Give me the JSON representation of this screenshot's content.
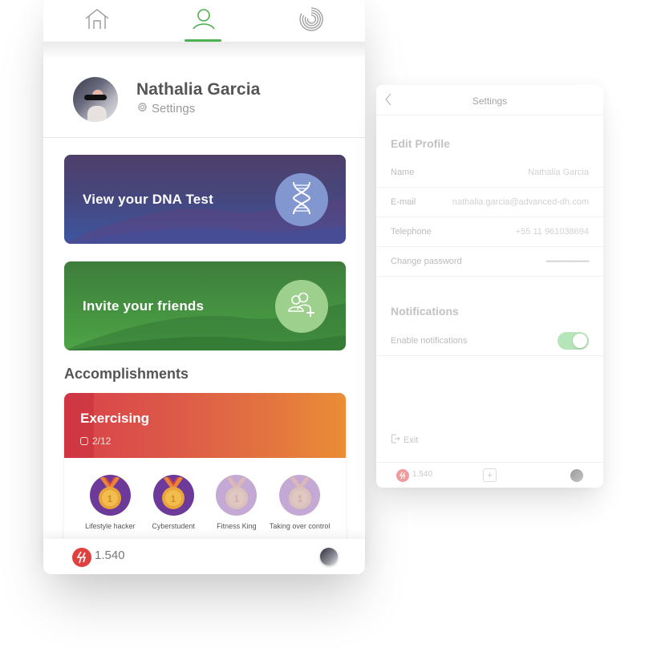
{
  "profile_screen": {
    "top_nav": {
      "tabs": [
        {
          "icon": "home-icon",
          "active": false
        },
        {
          "icon": "user-icon",
          "active": true
        },
        {
          "icon": "progress-rings-icon",
          "active": false
        }
      ],
      "active_color": "#4caf50"
    },
    "user": {
      "name": "Nathalia Garcia",
      "settings_label": "Settings"
    },
    "cards": [
      {
        "label": "View your DNA Test",
        "icon": "dna-icon"
      },
      {
        "label": "Invite your friends",
        "icon": "add-friends-icon"
      }
    ],
    "accomplishments": {
      "title": "Accomplishments",
      "category": {
        "title": "Exercising",
        "progress": "2/12"
      },
      "badges": [
        {
          "label": "Lifestyle hacker",
          "rank": "1",
          "earned": true
        },
        {
          "label": "Cyberstudent",
          "rank": "1",
          "earned": true
        },
        {
          "label": "Fitness King",
          "rank": "1",
          "earned": false
        },
        {
          "label": "Taking over control",
          "rank": "1",
          "earned": false
        }
      ]
    },
    "bottom_bar": {
      "points": "1.540"
    }
  },
  "settings_screen": {
    "title": "Settings",
    "edit_profile": {
      "title": "Edit Profile",
      "fields": [
        {
          "label": "Name",
          "value": "Nathalia Garcia"
        },
        {
          "label": "E-mail",
          "value": "nathalia.garcia@advanced-dh.com"
        },
        {
          "label": "Telephone",
          "value": "+55 11 961038694"
        },
        {
          "label": "Change password",
          "value": "•••••••••••••••••••••••••"
        }
      ]
    },
    "notifications": {
      "title": "Notifications",
      "enable_label": "Enable notifications",
      "enabled": true,
      "toggle_color": "#b5e5b9"
    },
    "exit_label": "Exit",
    "bottom_bar": {
      "points": "1.540",
      "add_label": "+"
    }
  }
}
